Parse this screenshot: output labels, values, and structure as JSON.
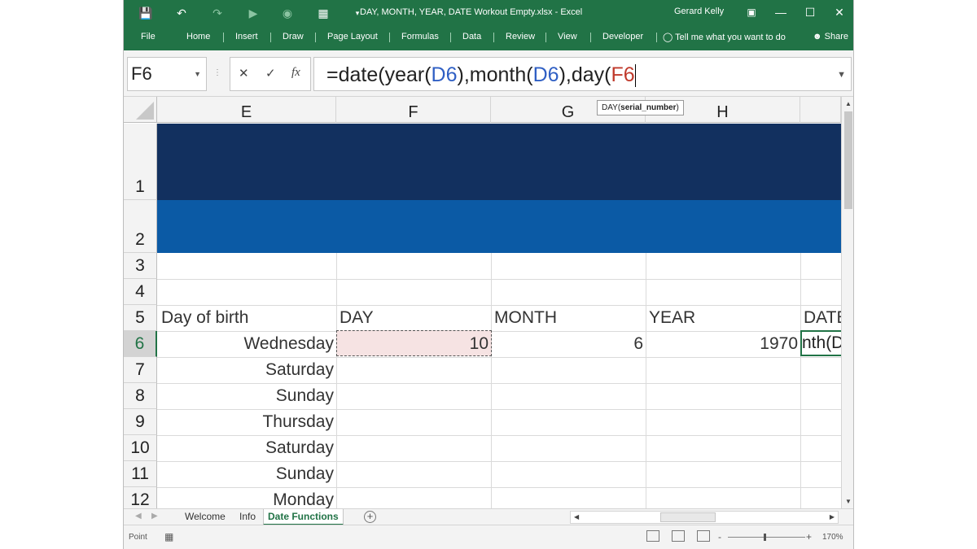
{
  "titlebar": {
    "title": "DAY, MONTH, YEAR, DATE Workout Empty.xlsx  -  Excel",
    "user": "Gerard Kelly",
    "accent": "#217346"
  },
  "ribbon": {
    "tabs": [
      "File",
      "Home",
      "Insert",
      "Draw",
      "Page Layout",
      "Formulas",
      "Data",
      "Review",
      "View",
      "Developer"
    ],
    "tell_me": "Tell me what you want to do",
    "share": "Share"
  },
  "formula_bar": {
    "name_box": "F6",
    "cancel": "✕",
    "enter": "✓",
    "fx": "fx",
    "formula_parts": [
      "=date(year(",
      "D6",
      "),month(",
      "D6",
      "),day(",
      "F6"
    ]
  },
  "tooltip": {
    "fn": "DAY(",
    "arg": "serial_number",
    "close": ")"
  },
  "grid": {
    "columns": [
      "E",
      "F",
      "G",
      "H"
    ],
    "rows": [
      "1",
      "2",
      "3",
      "4",
      "5",
      "6",
      "7",
      "8",
      "9",
      "10",
      "11",
      "12"
    ],
    "selected_row": "6",
    "headers_row5": [
      "Day of birth",
      "DAY",
      "MONTH",
      "YEAR",
      "DATE"
    ],
    "row6": {
      "day_of_birth": "Wednesday",
      "day": "10",
      "month": "6",
      "year": "1970",
      "date_partial": "nth(D"
    },
    "days": [
      "Saturday",
      "Sunday",
      "Thursday",
      "Saturday",
      "Sunday",
      "Monday"
    ],
    "band_colors": [
      "#12305f",
      "#0b5aa5"
    ]
  },
  "sheets": {
    "tabs": [
      "Welcome",
      "Info",
      "Date Functions"
    ],
    "active": "Date Functions"
  },
  "status": {
    "mode": "Point",
    "zoom": "170%"
  }
}
